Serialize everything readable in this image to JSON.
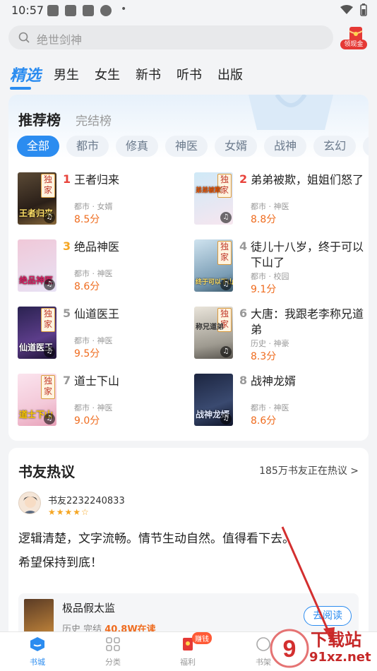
{
  "status": {
    "time": "10:57",
    "dot": "•"
  },
  "search": {
    "placeholder": "绝世剑神",
    "reward_label": "领现金"
  },
  "tabs": [
    "精选",
    "男生",
    "女生",
    "新书",
    "听书",
    "出版"
  ],
  "ranking": {
    "title": "推荐榜",
    "subtitle": "完结榜",
    "chips": [
      "全部",
      "都市",
      "修真",
      "神医",
      "女婿",
      "战神",
      "玄幻",
      "重"
    ],
    "books": [
      {
        "rank": "1",
        "name": "王者归来",
        "meta": "都市 · 女婿",
        "score": "8.5分",
        "cover_text": "王者归来",
        "exclusive": "独家"
      },
      {
        "rank": "2",
        "name": "弟弟被欺，姐姐们怒了",
        "meta": "都市 · 神医",
        "score": "8.8分",
        "cover_text": "弟弟被欺",
        "exclusive": "独家"
      },
      {
        "rank": "3",
        "name": "绝品神医",
        "meta": "都市 · 神医",
        "score": "8.6分",
        "cover_text": "绝品神医",
        "exclusive": ""
      },
      {
        "rank": "4",
        "name": "徒儿十八岁，终于可以下山了",
        "meta": "都市 · 校园",
        "score": "9.1分",
        "cover_text": "终于可以下山",
        "exclusive": "独家"
      },
      {
        "rank": "5",
        "name": "仙道医王",
        "meta": "都市 · 神医",
        "score": "9.5分",
        "cover_text": "仙道医王",
        "exclusive": "独家"
      },
      {
        "rank": "6",
        "name": "大唐：我跟老李称兄道弟",
        "meta": "历史 · 神豪",
        "score": "8.3分",
        "cover_text": "称兄道弟",
        "exclusive": "独家"
      },
      {
        "rank": "7",
        "name": "道士下山",
        "meta": "都市 · 神医",
        "score": "9.0分",
        "cover_text": "道士下山",
        "exclusive": "独家"
      },
      {
        "rank": "8",
        "name": "战神龙婿",
        "meta": "都市 · 神医",
        "score": "8.6分",
        "cover_text": "战神龙婿",
        "exclusive": ""
      }
    ]
  },
  "discussion": {
    "title": "书友热议",
    "more": "185万书友正在热议 >",
    "user": "书友2232240833",
    "stars": "★★★★☆",
    "comment": "逻辑清楚，文字流畅。情节生动自然。值得看下去。\n  希望保持到底！",
    "book": {
      "title": "极品假太监",
      "meta_prefix": "历史  完结  ",
      "readers": "40.8W在读",
      "read_button": "去阅读"
    }
  },
  "bottom_nav": [
    {
      "label": "书城",
      "active": true
    },
    {
      "label": "分类",
      "active": false
    },
    {
      "label": "福利",
      "active": false,
      "badge": "赚钱"
    },
    {
      "label": "书架",
      "active": false
    }
  ],
  "watermark": {
    "text1": "下载站",
    "text2": "91xz.net",
    "logo": "9"
  },
  "colors": {
    "accent": "#2b8cf0",
    "score": "#ef6c1f",
    "rank_top": "#e8433b",
    "rank_3": "#f5a623",
    "rank_rest": "#999999"
  }
}
